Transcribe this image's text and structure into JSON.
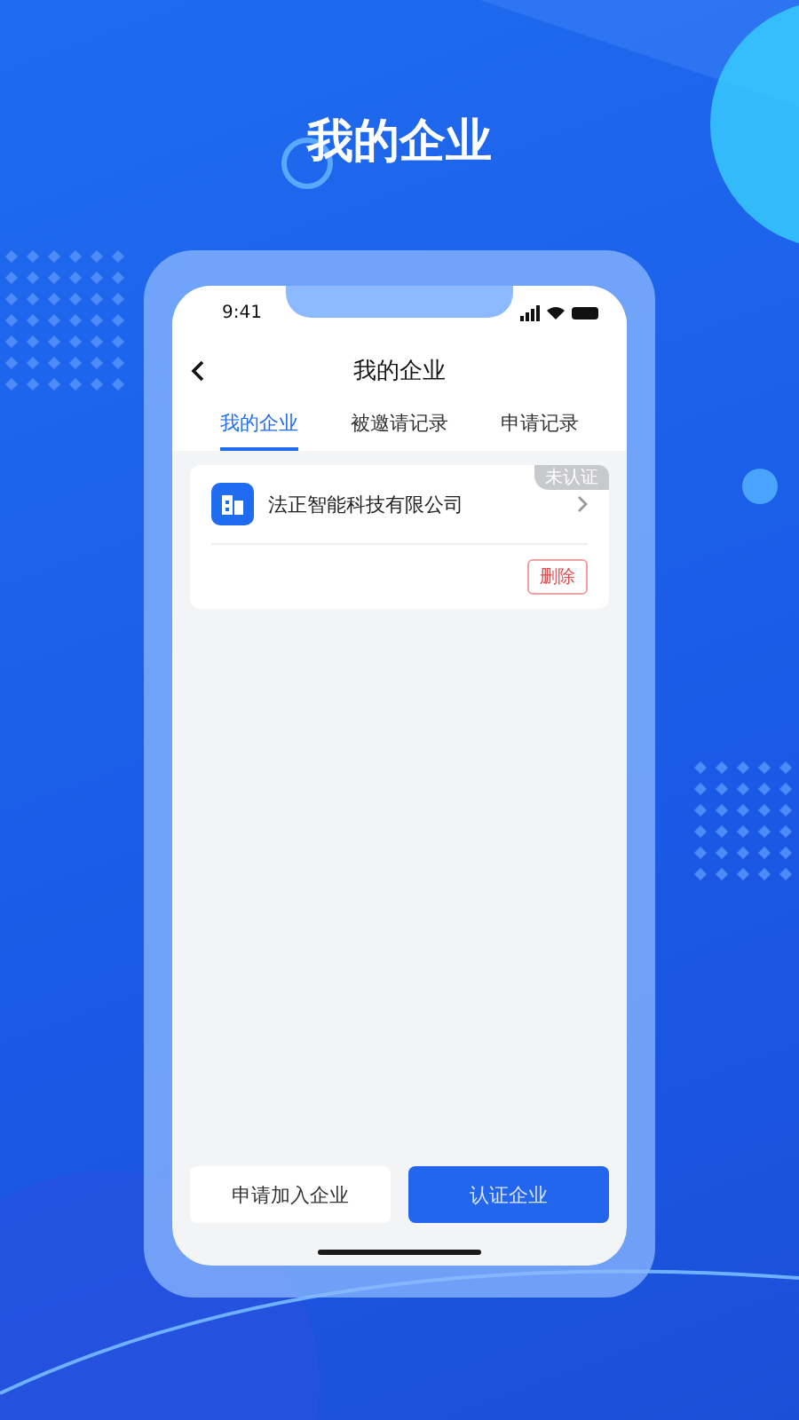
{
  "headline": "我的企业",
  "status_bar": {
    "time": "9:41"
  },
  "nav": {
    "title": "我的企业"
  },
  "tabs": [
    {
      "label": "我的企业",
      "selected": true
    },
    {
      "label": "被邀请记录",
      "selected": false
    },
    {
      "label": "申请记录",
      "selected": false
    }
  ],
  "companies": [
    {
      "name": "法正智能科技有限公司",
      "badge": "未认证",
      "action": "删除"
    }
  ],
  "buttons": [
    {
      "label": "申请加入企业",
      "kind": "secondary"
    },
    {
      "label": "认证企业",
      "kind": "primary"
    }
  ]
}
